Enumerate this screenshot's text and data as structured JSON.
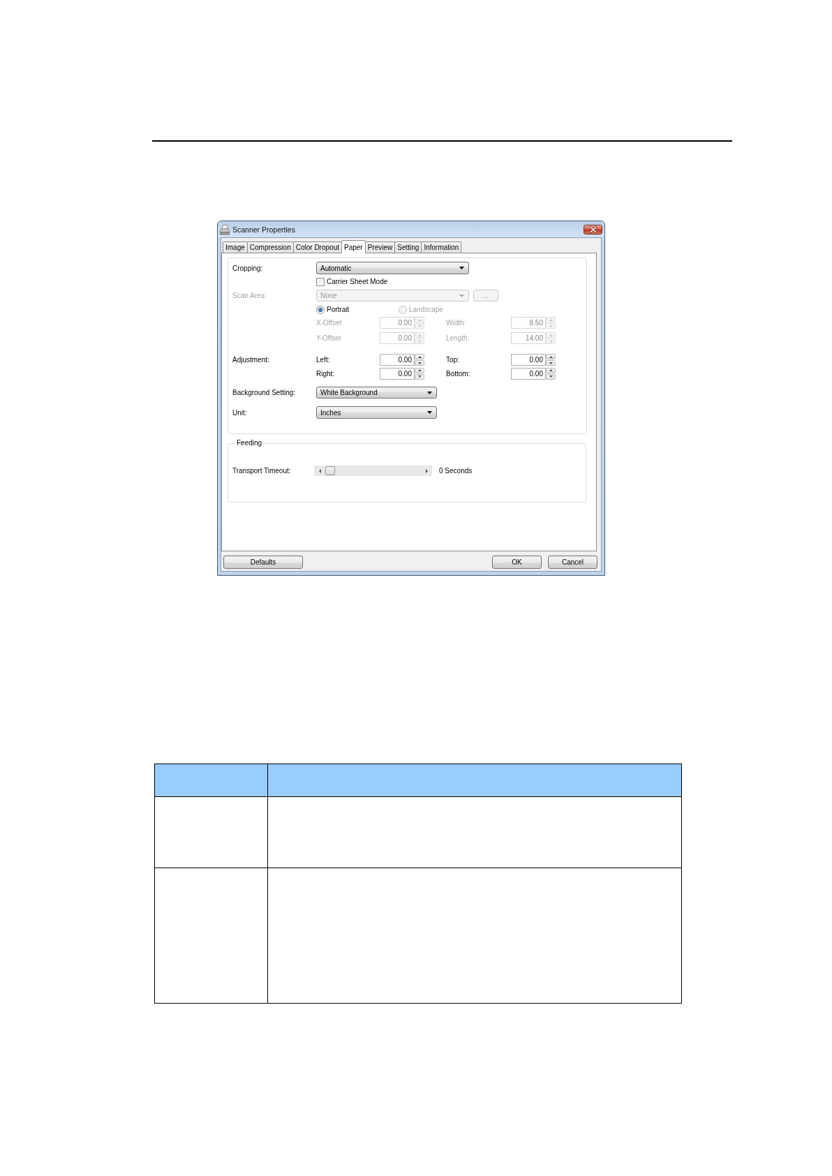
{
  "window": {
    "title": "Scanner Properties"
  },
  "tabs": [
    {
      "label": "Image",
      "selected": false
    },
    {
      "label": "Compression",
      "selected": false
    },
    {
      "label": "Color Dropout",
      "selected": false
    },
    {
      "label": "Paper",
      "selected": true
    },
    {
      "label": "Preview",
      "selected": false
    },
    {
      "label": "Setting",
      "selected": false
    },
    {
      "label": "Information",
      "selected": false
    }
  ],
  "paper": {
    "cropping": {
      "label": "Cropping:",
      "value": "Automatic"
    },
    "carrier_sheet_mode": {
      "label": "Carrier Sheet Mode",
      "checked": false
    },
    "scan_area": {
      "label": "Scan Area:",
      "value": "None",
      "disabled": true,
      "browse_button": "..."
    },
    "orientation": [
      {
        "label": "Portrait",
        "selected": true,
        "disabled": false
      },
      {
        "label": "Landscape",
        "selected": false,
        "disabled": true
      }
    ],
    "area_fields": [
      {
        "label": "X-Offset",
        "value": "0.00",
        "disabled": true
      },
      {
        "label": "Width:",
        "value": "8.50",
        "disabled": true
      },
      {
        "label": "Y-Offset",
        "value": "0.00",
        "disabled": true
      },
      {
        "label": "Length:",
        "value": "14.00",
        "disabled": true
      }
    ],
    "adjustment": {
      "label": "Adjustment:",
      "fields": [
        {
          "label": "Left:",
          "value": "0.00",
          "disabled": false
        },
        {
          "label": "Top:",
          "value": "0.00",
          "disabled": false
        },
        {
          "label": "Right:",
          "value": "0.00",
          "disabled": false
        },
        {
          "label": "Bottom:",
          "value": "0.00",
          "disabled": false
        }
      ]
    },
    "background_setting": {
      "label": "Background Setting:",
      "value": "White Background"
    },
    "unit": {
      "label": "Unit:",
      "value": "Inches"
    }
  },
  "feeding": {
    "title": "Feeding",
    "transport_timeout": {
      "label": "Transport Timeout:",
      "level": 0,
      "reading": "0 Seconds"
    }
  },
  "footer_buttons": {
    "left": [
      "Defaults"
    ],
    "right": [
      "OK",
      "Cancel"
    ]
  }
}
